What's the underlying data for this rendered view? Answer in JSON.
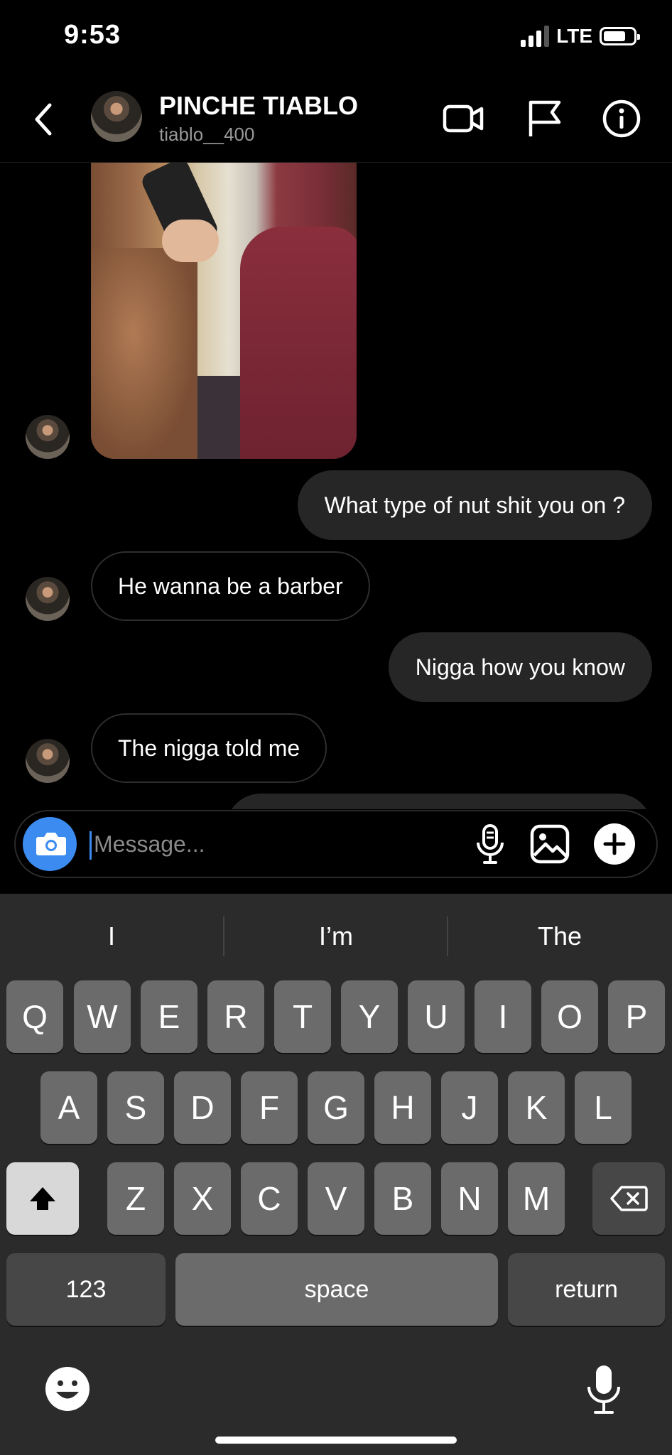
{
  "status_bar": {
    "time": "9:53",
    "network": "LTE",
    "battery_level": 0.8,
    "signal_bars": 3
  },
  "header": {
    "name": "PINCHE TIABLO",
    "username": "tiablo__400"
  },
  "messages": [
    {
      "direction": "out",
      "text": "What type of nut shit you on ?"
    },
    {
      "direction": "in",
      "text": "He wanna be a barber"
    },
    {
      "direction": "out",
      "text": "Nigga how you know"
    },
    {
      "direction": "in",
      "text": "The nigga told me"
    }
  ],
  "composer": {
    "placeholder": "Message..."
  },
  "keyboard": {
    "suggestions": [
      "I",
      "I’m",
      "The"
    ],
    "row1": [
      "Q",
      "W",
      "E",
      "R",
      "T",
      "Y",
      "U",
      "I",
      "O",
      "P"
    ],
    "row2": [
      "A",
      "S",
      "D",
      "F",
      "G",
      "H",
      "J",
      "K",
      "L"
    ],
    "row3": [
      "Z",
      "X",
      "C",
      "V",
      "B",
      "N",
      "M"
    ],
    "numbers_label": "123",
    "space_label": "space",
    "return_label": "return"
  },
  "icons": {
    "back": "chevron-left-icon",
    "video": "video-camera-icon",
    "flag": "flag-icon",
    "info": "info-icon",
    "camera": "camera-icon",
    "mic": "microphone-icon",
    "gallery": "image-icon",
    "add": "plus-icon",
    "shift": "shift-icon",
    "delete": "backspace-icon",
    "emoji": "emoji-icon",
    "dictation": "dictation-icon"
  },
  "colors": {
    "accent": "#3b8bf0",
    "background": "#000000",
    "outgoing_bubble": "#262626",
    "keyboard_bg": "#2b2b2b"
  }
}
